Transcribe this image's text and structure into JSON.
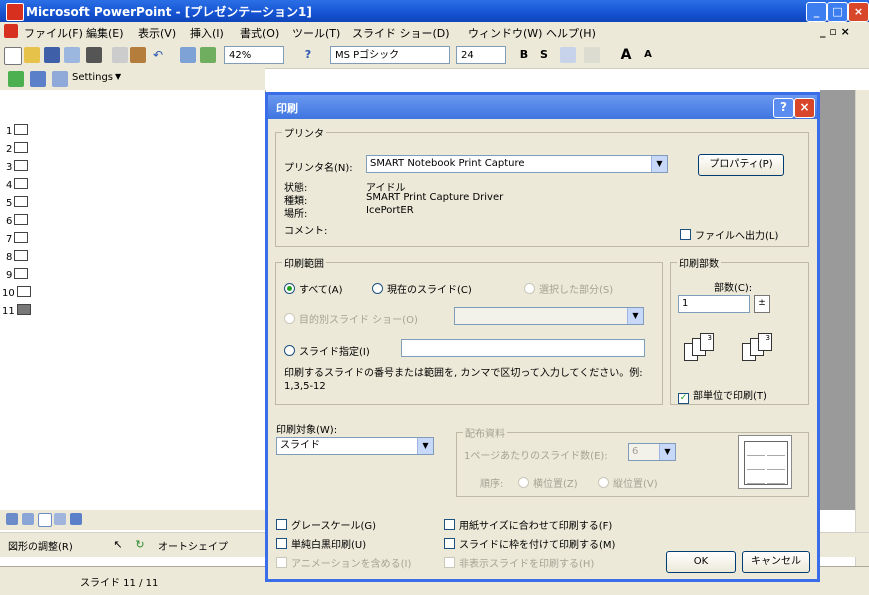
{
  "window": {
    "title": "Microsoft PowerPoint - [プレゼンテーション1]",
    "min": "_",
    "max": "□",
    "close": "×"
  },
  "menu": {
    "items": [
      "ファイル(F)",
      "編集(E)",
      "表示(V)",
      "挿入(I)",
      "書式(O)",
      "ツール(T)",
      "スライド ショー(D)",
      "ウィンドウ(W)",
      "ヘルプ(H)"
    ],
    "doc_controls": "_ ▫ ×"
  },
  "toolbar": {
    "zoom": "42%",
    "font": "MS Pゴシック",
    "size": "24",
    "bold": "B",
    "shadow": "S",
    "grow": "A",
    "shrink": "A"
  },
  "outline_bar": {
    "settings": "Settings"
  },
  "slides": [
    "1",
    "2",
    "3",
    "4",
    "5",
    "6",
    "7",
    "8",
    "9",
    "10",
    "11"
  ],
  "drawing": {
    "adjust": "図形の調整(R)",
    "autoshapes": "オートシェイプ"
  },
  "status": {
    "slide_indicator": "スライド 11 / 11"
  },
  "dialog": {
    "title": "印刷",
    "help": "?",
    "close": "×",
    "printer": {
      "legend": "プリンタ",
      "name_label": "プリンタ名(N):",
      "name_value": "SMART Notebook Print Capture",
      "properties": "プロパティ(P)",
      "status_label": "状態:",
      "status_value": "アイドル",
      "type_label": "種類:",
      "type_value": "SMART Print Capture Driver",
      "where_label": "場所:",
      "where_value": "IcePortER",
      "comment_label": "コメント:",
      "print_to_file": "ファイルへ出力(L)"
    },
    "range": {
      "legend": "印刷範囲",
      "all": "すべて(A)",
      "current": "現在のスライド(C)",
      "selection": "選択した部分(S)",
      "custom_show": "目的別スライド ショー(O)",
      "slides": "スライド指定(I)",
      "hint": "印刷するスライドの番号または範囲を, カンマで区切って入力してください。例: 1,3,5-12"
    },
    "copies": {
      "legend": "印刷部数",
      "count_label": "部数(C):",
      "count_value": "1",
      "collate": "部単位で印刷(T)"
    },
    "print_what": {
      "label": "印刷対象(W):",
      "value": "スライド"
    },
    "handouts": {
      "legend": "配布資料",
      "per_page_label": "1ページあたりのスライド数(E):",
      "per_page_value": "6",
      "order_label": "順序:",
      "horizontal": "横位置(Z)",
      "vertical": "縦位置(V)"
    },
    "options": {
      "grayscale": "グレースケール(G)",
      "pure_bw": "単純白黒印刷(U)",
      "animations": "アニメーションを含める(I)",
      "scale_to_fit": "用紙サイズに合わせて印刷する(F)",
      "frame": "スライドに枠を付けて印刷する(M)",
      "hidden": "非表示スライドを印刷する(H)"
    },
    "ok": "OK",
    "cancel": "キャンセル"
  }
}
